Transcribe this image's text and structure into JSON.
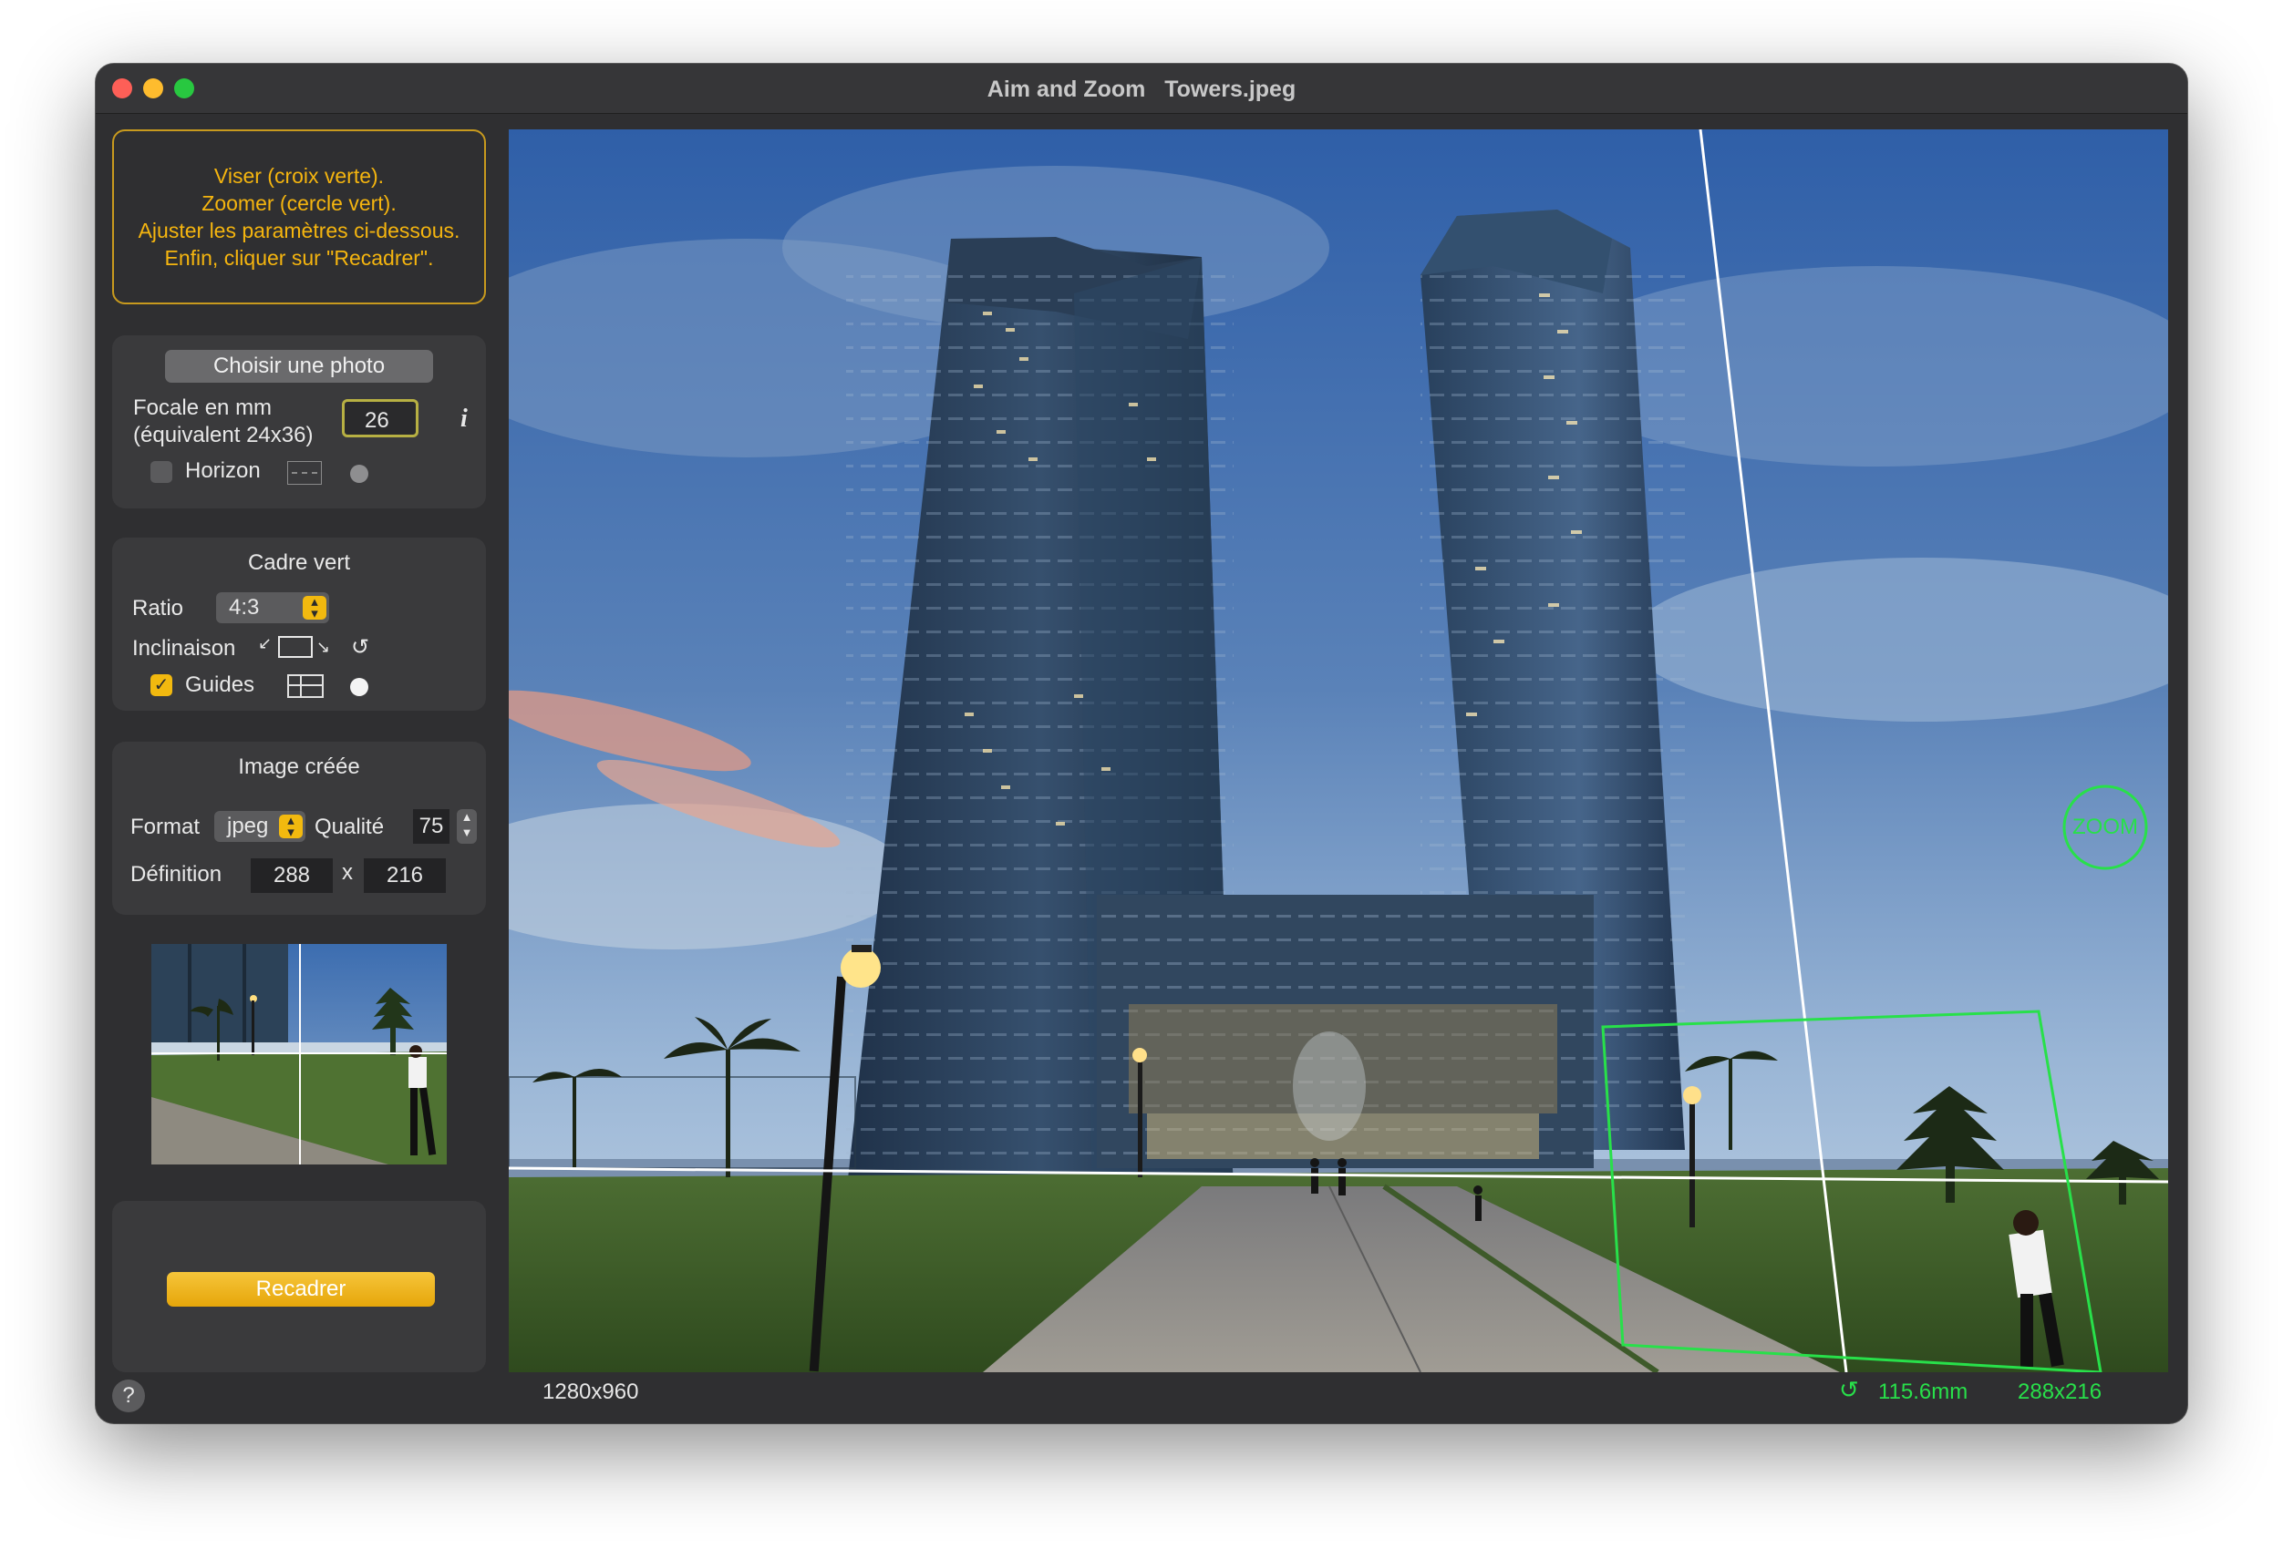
{
  "window": {
    "title": "Aim and Zoom   Towers.jpeg"
  },
  "instructions": {
    "line1": "Viser (croix verte).",
    "line2": "Zoomer (cercle vert).",
    "line3": "Ajuster les paramètres ci-dessous.",
    "line4": "Enfin, cliquer sur \"Recadrer\"."
  },
  "photo_panel": {
    "choose_label": "Choisir une photo",
    "focal_label_1": "Focale en mm",
    "focal_label_2": "(équivalent 24x36)",
    "focal_value": "26",
    "info_label": "i",
    "horizon_label": "Horizon",
    "horizon_checked": false
  },
  "frame_panel": {
    "title": "Cadre vert",
    "ratio_label": "Ratio",
    "ratio_value": "4:3",
    "tilt_label": "Inclinaison",
    "guides_label": "Guides",
    "guides_checked": true
  },
  "output_panel": {
    "title": "Image créée",
    "format_label": "Format",
    "format_value": "jpeg",
    "quality_label": "Qualité",
    "quality_value": "75",
    "definition_label": "Définition",
    "width_value": "288",
    "x_label": "x",
    "height_value": "216"
  },
  "action": {
    "recadrer_label": "Recadrer"
  },
  "viewer": {
    "zoom_label": "ZOOM",
    "image_size": "1280x960",
    "focal_equivalent": "115.6mm",
    "crop_size": "288x216"
  },
  "help_label": "?",
  "colors": {
    "accent": "#f2b90f",
    "green": "#28e04a",
    "window_bg": "#2f2f31",
    "panel_bg": "#3a3a3c"
  }
}
